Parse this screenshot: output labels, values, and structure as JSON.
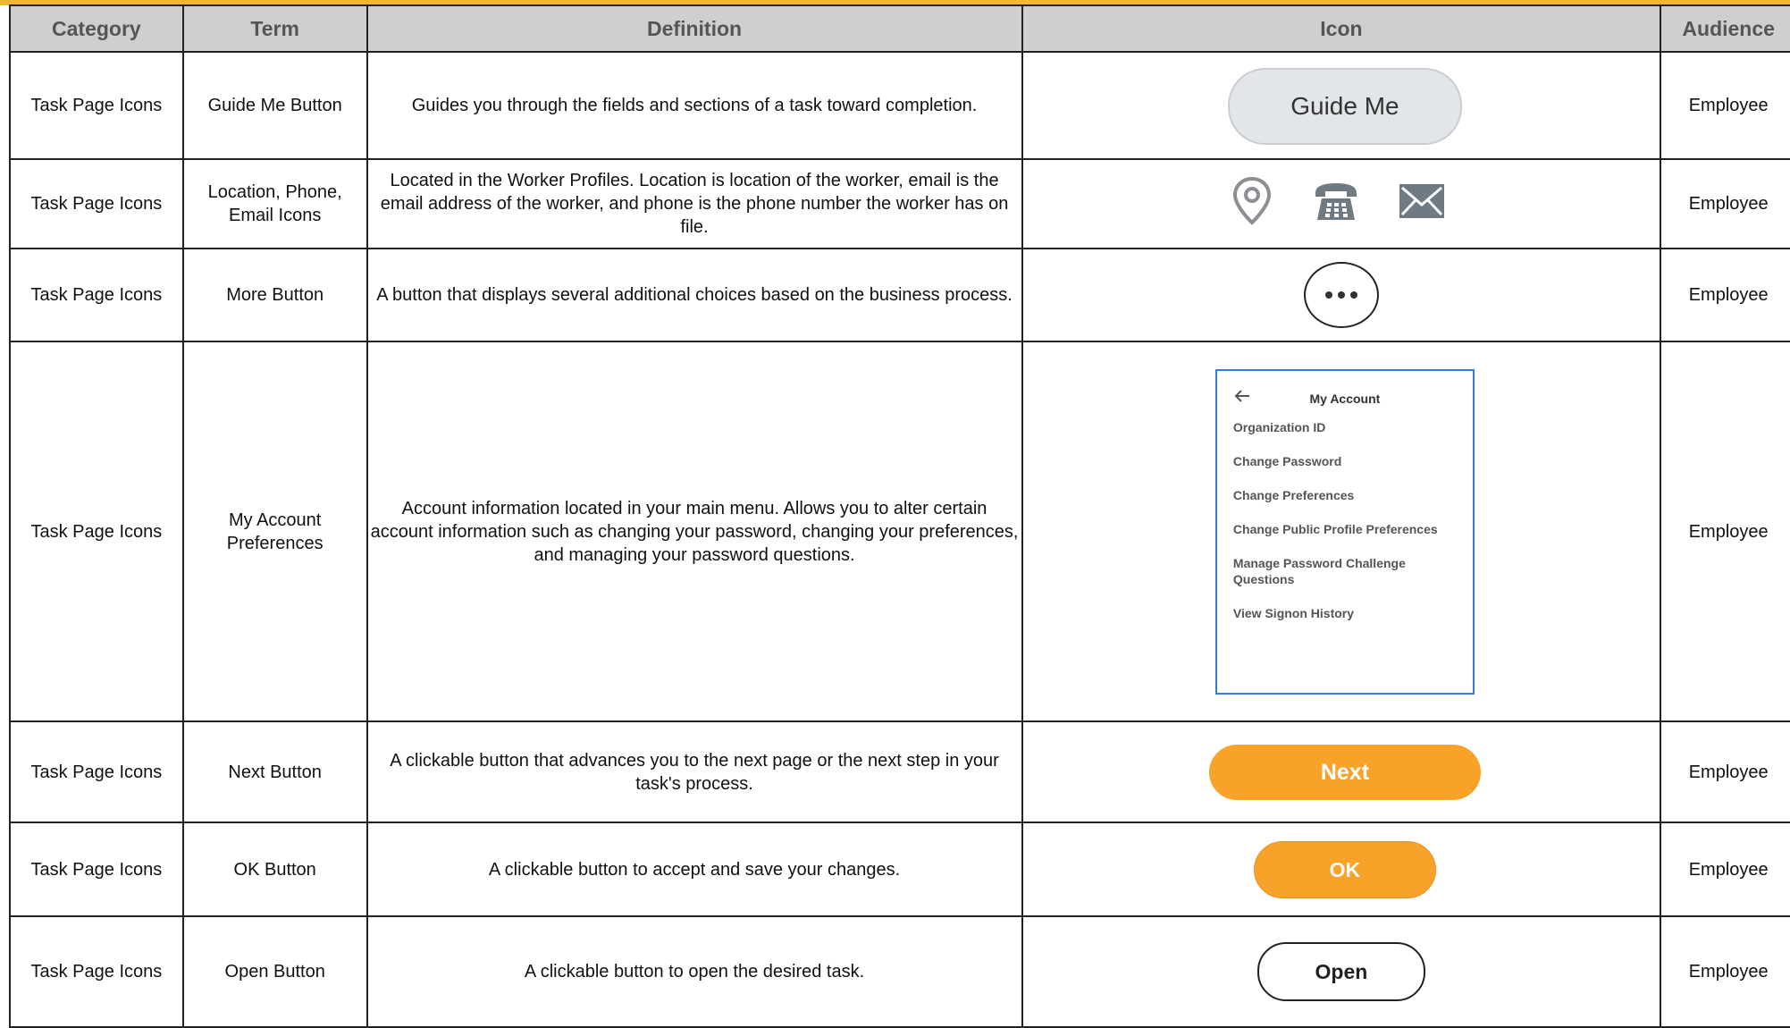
{
  "headers": {
    "category": "Category",
    "term": "Term",
    "definition": "Definition",
    "icon": "Icon",
    "audience": "Audience"
  },
  "rows": [
    {
      "category": "Task Page Icons",
      "term": "Guide Me Button",
      "definition": "Guides you through the fields and sections of a task toward completion.",
      "icon_label": "Guide Me",
      "audience": "Employee"
    },
    {
      "category": "Task Page Icons",
      "term": "Location, Phone, Email Icons",
      "definition": "Located in the Worker Profiles. Location is location of the worker, email is the email address of the worker, and phone is the phone number the worker has on file.",
      "icon_names": [
        "location-pin-icon",
        "phone-icon",
        "email-icon"
      ],
      "audience": "Employee"
    },
    {
      "category": "Task Page Icons",
      "term": "More Button",
      "definition": "A button that displays several additional choices based on the business process.",
      "icon_name": "more-dots-icon",
      "audience": "Employee"
    },
    {
      "category": "Task Page Icons",
      "term": "My Account Preferences",
      "definition": "Account information located in your main menu. Allows you to alter certain account information such as changing your password, changing your preferences, and managing your password questions.",
      "panel": {
        "title": "My Account",
        "items": [
          "Organization ID",
          "Change Password",
          "Change Preferences",
          "Change Public Profile Preferences",
          "Manage Password Challenge Questions",
          "View Signon History"
        ]
      },
      "audience": "Employee"
    },
    {
      "category": "Task Page Icons",
      "term": "Next Button",
      "definition": "A clickable button that advances you to the next page or the next step in your task's process.",
      "icon_label": "Next",
      "audience": "Employee"
    },
    {
      "category": "Task Page Icons",
      "term": "OK Button",
      "definition": "A clickable button to accept and save your changes.",
      "icon_label": "OK",
      "audience": "Employee"
    },
    {
      "category": "Task Page Icons",
      "term": "Open Button",
      "definition": "A clickable button to open the desired task.",
      "icon_label": "Open",
      "audience": "Employee"
    }
  ],
  "colors": {
    "accent_bar": "#f2b634",
    "header_bg": "#d0cfd0",
    "orange_button": "#f8a229",
    "panel_border": "#2f7fd6"
  }
}
